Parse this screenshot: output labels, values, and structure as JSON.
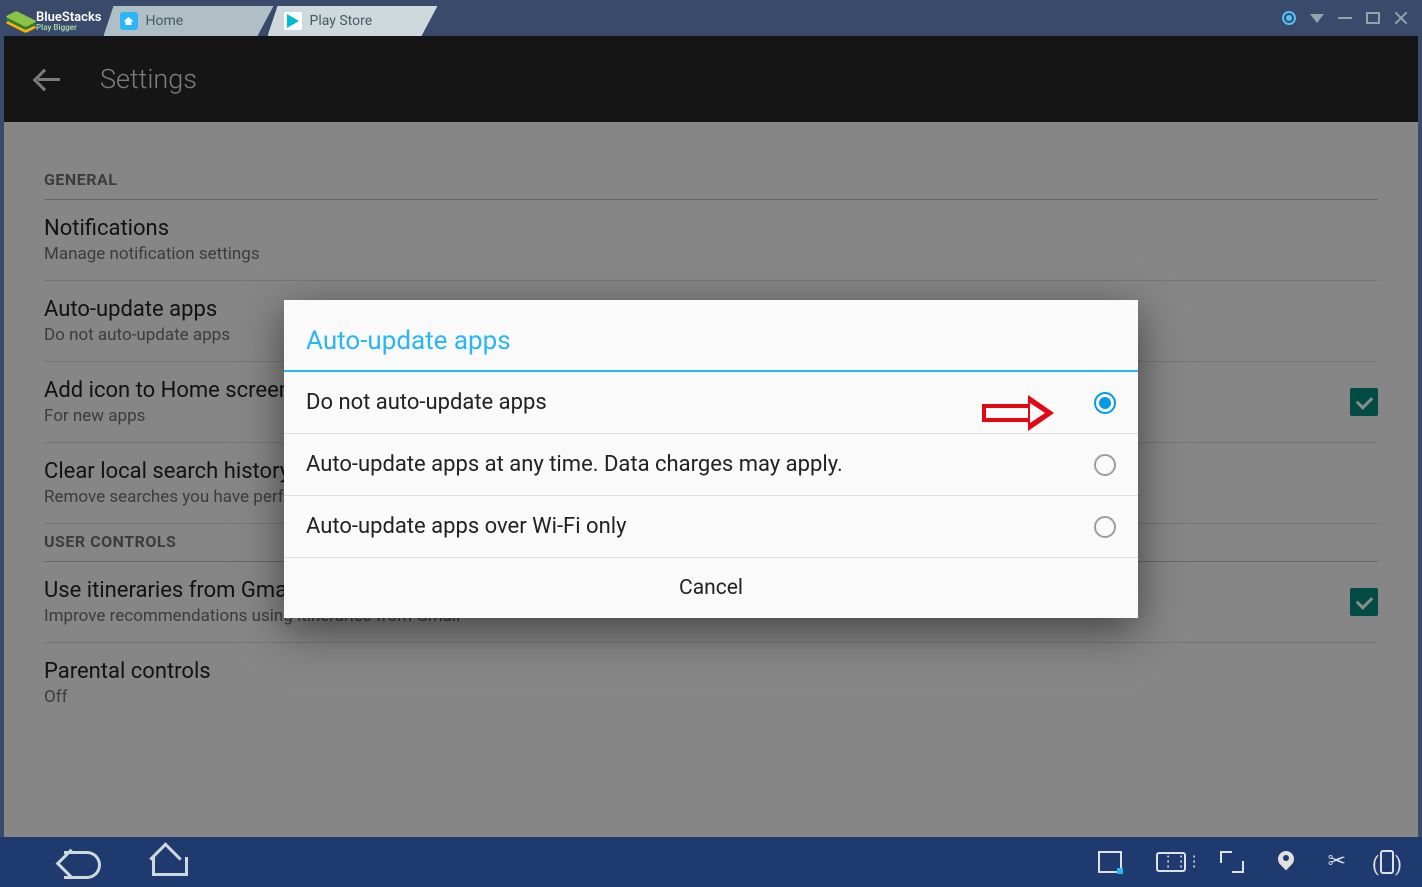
{
  "bluestacks": {
    "brand": "BlueStacks",
    "tagline": "Play Bigger",
    "tabs": [
      {
        "label": "Home"
      },
      {
        "label": "Play Store"
      }
    ]
  },
  "app": {
    "header_title": "Settings",
    "sections": {
      "general": {
        "header": "GENERAL",
        "items": [
          {
            "title": "Notifications",
            "sub": "Manage notification settings"
          },
          {
            "title": "Auto-update apps",
            "sub": "Do not auto-update apps"
          },
          {
            "title": "Add icon to Home screen",
            "sub": "For new apps",
            "checked": true
          },
          {
            "title": "Clear local search history",
            "sub": "Remove searches you have performed from this device"
          }
        ]
      },
      "user_controls": {
        "header": "USER CONTROLS",
        "items": [
          {
            "title": "Use itineraries from Gmail",
            "sub": "Improve recommendations using itineraries from Gmail",
            "checked": true
          },
          {
            "title": "Parental controls",
            "sub": "Off"
          }
        ]
      }
    }
  },
  "dialog": {
    "title": "Auto-update apps",
    "options": [
      {
        "label": "Do not auto-update apps",
        "selected": true
      },
      {
        "label": "Auto-update apps at any time. Data charges may apply.",
        "selected": false
      },
      {
        "label": "Auto-update apps over Wi-Fi only",
        "selected": false
      }
    ],
    "cancel": "Cancel"
  }
}
